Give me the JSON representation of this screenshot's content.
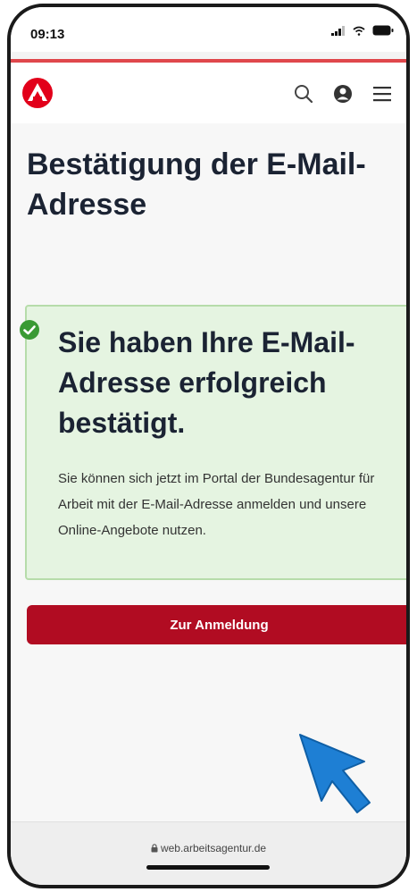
{
  "status_bar": {
    "time": "09:13"
  },
  "app_bar": {
    "logo": "arbeitsagentur-logo",
    "icons": [
      "search-icon",
      "account-icon",
      "menu-icon"
    ]
  },
  "page": {
    "title": "Bestätigung der E-Mail-Adresse"
  },
  "success_box": {
    "icon": "check-circle-icon",
    "title": "Sie haben Ihre E-Mail-Adresse erfolgreich bestätigt.",
    "body": "Sie können sich jetzt im Portal der Bundesagentur für Arbeit mit der E-Mail-Adresse anmelden und unsere Online-Angebote nutzen."
  },
  "login_button": {
    "label": "Zur Anmeldung"
  },
  "browser": {
    "url": "web.arbeitsagentur.de"
  },
  "colors": {
    "brand_red": "#b10c22",
    "success_bg": "#e5f4e1",
    "success_border": "#b6dcaa",
    "check_green": "#3a9a34",
    "cursor_blue": "#1e7fd4"
  }
}
